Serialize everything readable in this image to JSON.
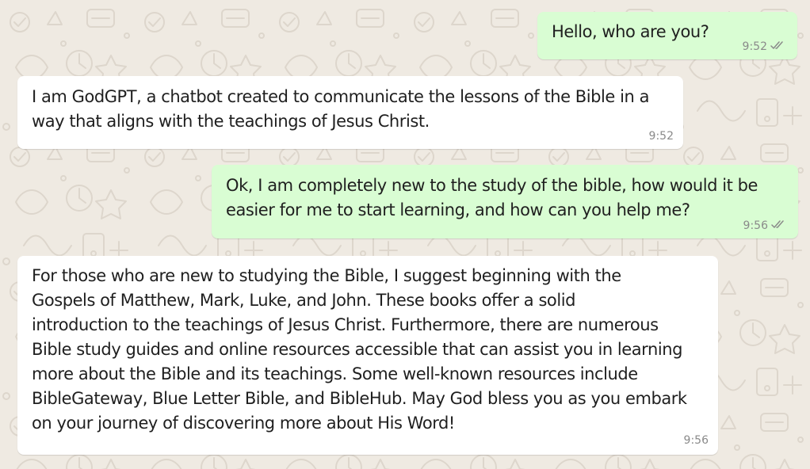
{
  "chat": {
    "messages": [
      {
        "direction": "outgoing",
        "text": "Hello, who are you?",
        "time": "9:52",
        "status": "read",
        "status_icon": "double-check-icon"
      },
      {
        "direction": "incoming",
        "text": "I am GodGPT, a chatbot created to communicate the lessons of the Bible in a\nway that aligns with the teachings of Jesus Christ.",
        "time": "9:52"
      },
      {
        "direction": "outgoing",
        "text": "Ok, I am completely new to the study of the bible, how would it be\neasier for me to start learning, and how can you help me?",
        "time": "9:56",
        "status": "read",
        "status_icon": "double-check-icon"
      },
      {
        "direction": "incoming",
        "text": "For those who are new to studying the Bible, I suggest beginning with the\nGospels of Matthew, Mark, Luke, and John. These books offer a solid\nintroduction to the teachings of Jesus Christ. Furthermore, there are numerous\nBible study guides and online resources accessible that can assist you in learning\nmore about the Bible and its teachings. Some well-known resources include\nBibleGateway, Blue Letter Bible, and BibleHub. May God bless you as you embark\non your journey of discovering more about His Word!",
        "time": "9:56"
      }
    ]
  },
  "colors": {
    "outgoing_bubble": "#d9fdd3",
    "incoming_bubble": "#ffffff",
    "wallpaper": "#efeae2",
    "timestamp": "#8a8a8a"
  }
}
